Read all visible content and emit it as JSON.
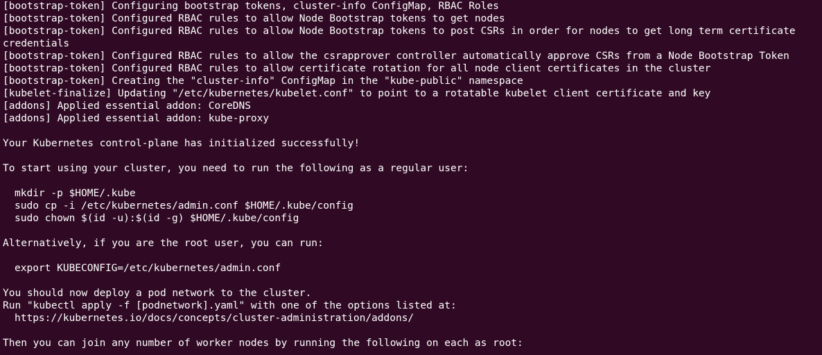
{
  "terminal": {
    "background": "#300a24",
    "foreground": "#ffffff",
    "lines": [
      {
        "text": "[bootstrap-token] Configuring bootstrap tokens, cluster-info ConfigMap, RBAC Roles",
        "indent": false
      },
      {
        "text": "[bootstrap-token] Configured RBAC rules to allow Node Bootstrap tokens to get nodes",
        "indent": false
      },
      {
        "text": "[bootstrap-token] Configured RBAC rules to allow Node Bootstrap tokens to post CSRs in order for nodes to get long term certificate",
        "indent": false
      },
      {
        "text": "credentials",
        "indent": false
      },
      {
        "text": "[bootstrap-token] Configured RBAC rules to allow the csrapprover controller automatically approve CSRs from a Node Bootstrap Token",
        "indent": false
      },
      {
        "text": "[bootstrap-token] Configured RBAC rules to allow certificate rotation for all node client certificates in the cluster",
        "indent": false
      },
      {
        "text": "[bootstrap-token] Creating the \"cluster-info\" ConfigMap in the \"kube-public\" namespace",
        "indent": false
      },
      {
        "text": "[kubelet-finalize] Updating \"/etc/kubernetes/kubelet.conf\" to point to a rotatable kubelet client certificate and key",
        "indent": false
      },
      {
        "text": "[addons] Applied essential addon: CoreDNS",
        "indent": false
      },
      {
        "text": "[addons] Applied essential addon: kube-proxy",
        "indent": false
      },
      {
        "text": "",
        "indent": false
      },
      {
        "text": "Your Kubernetes control-plane has initialized successfully!",
        "indent": false
      },
      {
        "text": "",
        "indent": false
      },
      {
        "text": "To start using your cluster, you need to run the following as a regular user:",
        "indent": false
      },
      {
        "text": "",
        "indent": false
      },
      {
        "text": "mkdir -p $HOME/.kube",
        "indent": true
      },
      {
        "text": "sudo cp -i /etc/kubernetes/admin.conf $HOME/.kube/config",
        "indent": true
      },
      {
        "text": "sudo chown $(id -u):$(id -g) $HOME/.kube/config",
        "indent": true
      },
      {
        "text": "",
        "indent": false
      },
      {
        "text": "Alternatively, if you are the root user, you can run:",
        "indent": false
      },
      {
        "text": "",
        "indent": false
      },
      {
        "text": "export KUBECONFIG=/etc/kubernetes/admin.conf",
        "indent": true
      },
      {
        "text": "",
        "indent": false
      },
      {
        "text": "You should now deploy a pod network to the cluster.",
        "indent": false
      },
      {
        "text": "Run \"kubectl apply -f [podnetwork].yaml\" with one of the options listed at:",
        "indent": false
      },
      {
        "text": "https://kubernetes.io/docs/concepts/cluster-administration/addons/",
        "indent": true
      },
      {
        "text": "",
        "indent": false
      },
      {
        "text": "Then you can join any number of worker nodes by running the following on each as root:",
        "indent": false
      }
    ]
  }
}
